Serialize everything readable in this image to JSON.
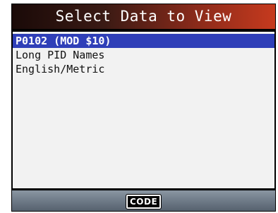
{
  "title": "Select Data to View",
  "menu": {
    "items": [
      {
        "label": "P0102 (MOD $10)",
        "selected": true
      },
      {
        "label": "Long PID Names",
        "selected": false
      },
      {
        "label": "English/Metric",
        "selected": false
      }
    ]
  },
  "footer": {
    "code_label": "CODE"
  },
  "colors": {
    "selection": "#2f3fb8",
    "title_accent": "#c63a1e",
    "panel_bg": "#f2f2f2"
  }
}
